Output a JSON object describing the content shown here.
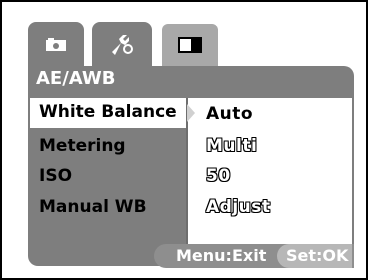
{
  "tabs": [
    {
      "icon": "camera-icon"
    },
    {
      "icon": "wrench-icon"
    },
    {
      "icon": "playback-icon"
    }
  ],
  "panel": {
    "title": "AE/AWB",
    "items": [
      {
        "label": "White Balance",
        "selected": true
      },
      {
        "label": "Metering",
        "selected": false
      },
      {
        "label": "ISO",
        "selected": false
      },
      {
        "label": "Manual WB",
        "selected": false
      }
    ]
  },
  "options": [
    {
      "label": "Auto",
      "selected": true
    },
    {
      "label": "Multi",
      "selected": false
    },
    {
      "label": "50",
      "selected": false
    },
    {
      "label": "Adjust",
      "selected": false
    }
  ],
  "footer": {
    "menu_label": "Menu:Exit",
    "set_label": "Set:OK"
  }
}
